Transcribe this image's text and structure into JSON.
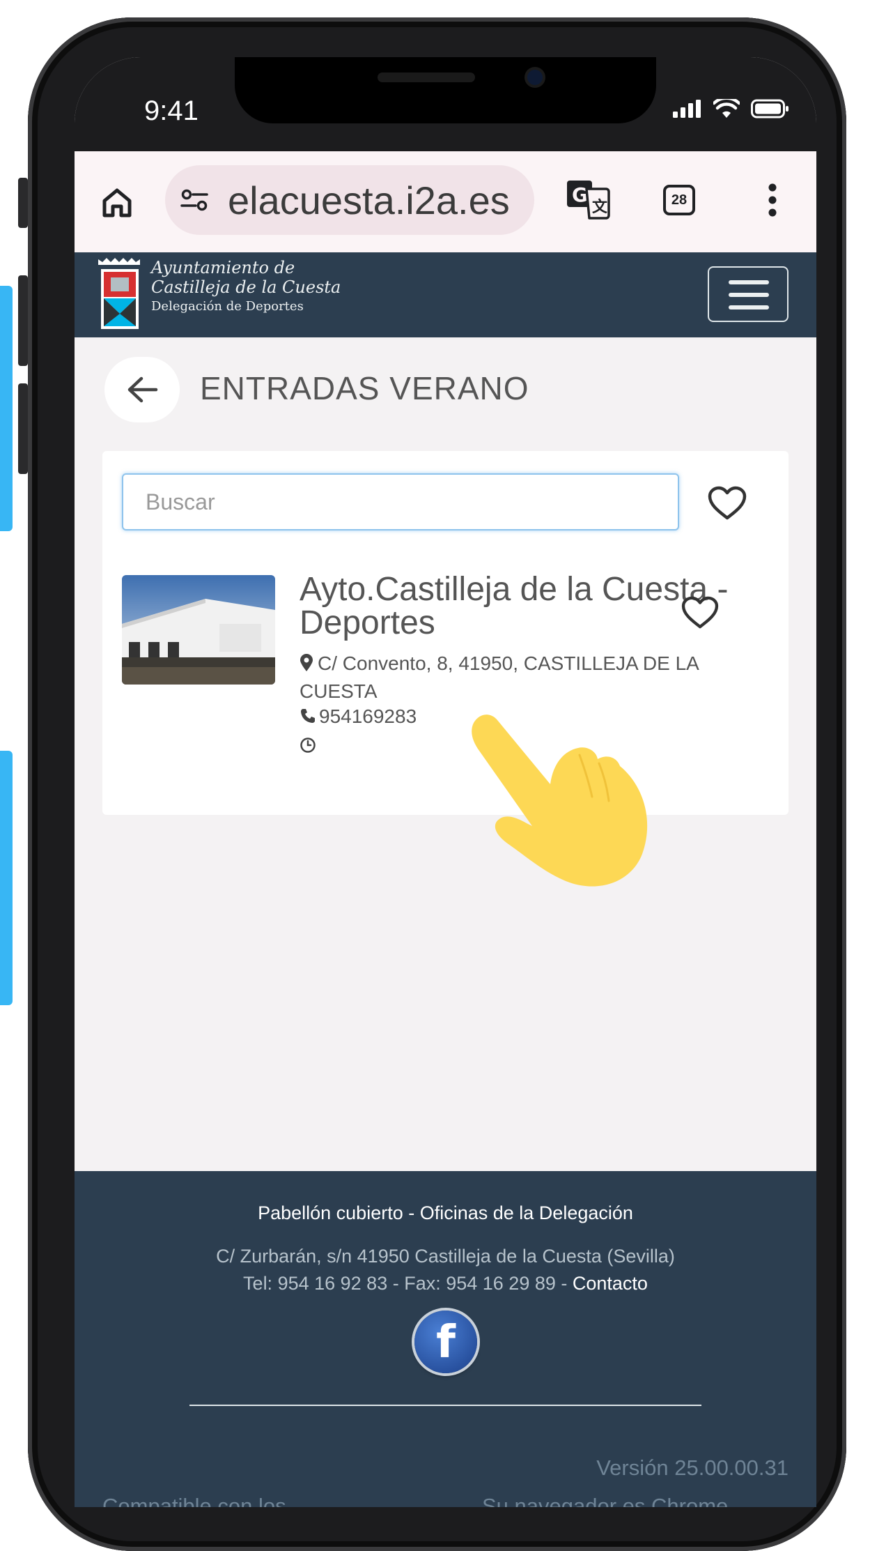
{
  "status_bar": {
    "time": "9:41"
  },
  "browser": {
    "url": "elacuesta.i2a.es",
    "tabs_count": "28"
  },
  "site_header": {
    "logo_line1": "Ayuntamiento de",
    "logo_line2": "Castilleja de la Cuesta",
    "logo_line3": "Delegación de Deportes"
  },
  "page": {
    "title": "ENTRADAS VERANO"
  },
  "search": {
    "placeholder": "Buscar",
    "value": ""
  },
  "entity": {
    "name": "Ayto.Castilleja de la Cuesta - Deportes",
    "address": "C/ Convento, 8, 41950, CASTILLEJA DE LA CUESTA",
    "phone": "954169283"
  },
  "footer": {
    "line1": "Pabellón cubierto - Oficinas de la Delegación",
    "line2": "C/ Zurbarán, s/n 41950 Castilleja de la Cuesta (Sevilla)",
    "line3_prefix": "Tel: 954 16 92 83 - Fax: 954 16 29 89 - ",
    "contact_link": "Contacto",
    "version": "Versión 25.00.00.31",
    "compat": "Compatible con los",
    "browser_info": "Su navegador es Chrome"
  },
  "colors": {
    "header_bg": "#2c3e50",
    "page_bg": "#f4f2f3",
    "accent_side": "#38b6f4",
    "hand": "#fdd855"
  },
  "icons": [
    "home-icon",
    "site-settings-icon",
    "translate-icon",
    "tabs-icon",
    "more-vert-icon",
    "menu-icon",
    "back-arrow-icon",
    "heart-icon",
    "location-icon",
    "phone-icon",
    "clock-icon",
    "facebook-icon",
    "pointing-hand-icon"
  ]
}
